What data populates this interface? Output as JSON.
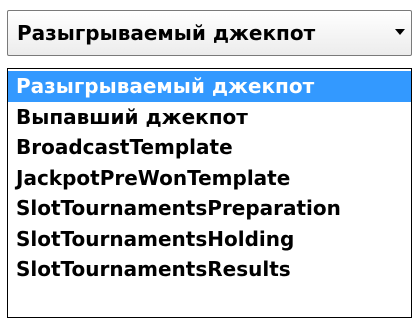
{
  "select": {
    "current_value": "Разыгрываемый джекпот",
    "arrow_icon": "chevron-down-icon"
  },
  "options": [
    {
      "label": "Разыгрываемый джекпот"
    },
    {
      "label": "Выпавший джекпот"
    },
    {
      "label": "BroadcastTemplate"
    },
    {
      "label": "JackpotPreWonTemplate"
    },
    {
      "label": "SlotTournamentsPreparation"
    },
    {
      "label": "SlotTournamentsHolding"
    },
    {
      "label": "SlotTournamentsResults"
    }
  ],
  "colors": {
    "highlight": "#3399ff",
    "highlight_text": "#ffffff"
  }
}
